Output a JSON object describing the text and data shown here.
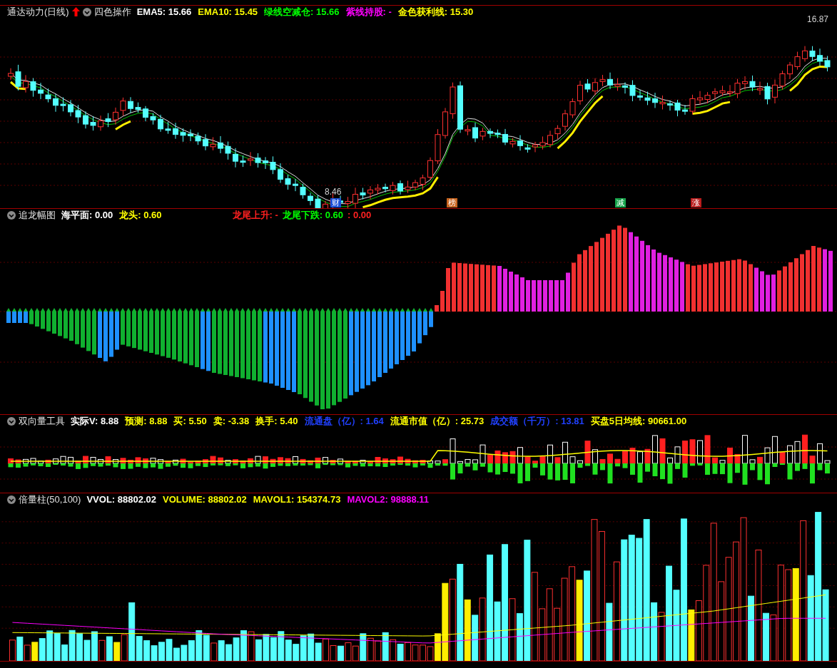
{
  "main_panel": {
    "title": "通达动力(日线)",
    "indicator": "四色操作",
    "values": [
      {
        "text": "EMA5: 15.66",
        "color": "#ffffff"
      },
      {
        "text": "EMA10: 15.45",
        "color": "#ffff00"
      },
      {
        "text": "绿线空减仓: 15.66",
        "color": "#00ff00"
      },
      {
        "text": "紫线持股: -",
        "color": "#ff00ff"
      },
      {
        "text": "金色获利线: 15.30",
        "color": "#ffff00"
      }
    ],
    "high_label": "16.87",
    "low_label": "8.46",
    "markers": [
      {
        "text": "财",
        "color": "#1a4fd6"
      },
      {
        "text": "榜",
        "color": "#c8641e"
      },
      {
        "text": "减",
        "color": "#16a34a"
      },
      {
        "text": "涨",
        "color": "#b91c1c"
      }
    ]
  },
  "dragon_panel": {
    "title": "追龙幅图",
    "values": [
      {
        "text": "海平面: 0.00",
        "color": "#ffffff"
      },
      {
        "text": "龙头: 0.60",
        "color": "#ffff00"
      }
    ],
    "values_right": [
      {
        "text": "龙尾上升: -",
        "color": "#ff2020"
      },
      {
        "text": "龙尾下跌: 0.60",
        "color": "#00ff00"
      },
      {
        "text": ": 0.00",
        "color": "#ff2020"
      }
    ]
  },
  "volume_tool_panel": {
    "title": "双向量工具",
    "values": [
      {
        "text": "实际V: 8.88",
        "color": "#ffffff"
      },
      {
        "text": "预测: 8.88",
        "color": "#ffff00"
      },
      {
        "text": "买: 5.50",
        "color": "#ffff00"
      },
      {
        "text": "卖: -3.38",
        "color": "#ffff00"
      },
      {
        "text": "换手: 5.40",
        "color": "#ffff00"
      },
      {
        "text": "流通盘（亿）: 1.64",
        "color": "#2040ff"
      },
      {
        "text": "流通市值（亿）: 25.73",
        "color": "#ffff00"
      },
      {
        "text": "成交额（千万）: 13.81",
        "color": "#2040ff"
      },
      {
        "text": "买盘5日均线: 90661.00",
        "color": "#ffff00"
      }
    ]
  },
  "volume_panel": {
    "title": "倍量柱(50,100)",
    "values": [
      {
        "text": "VVOL: 88802.02",
        "color": "#ffffff"
      },
      {
        "text": "VOLUME: 88802.02",
        "color": "#ffff00"
      },
      {
        "text": "MAVOL1: 154374.73",
        "color": "#ffff00"
      },
      {
        "text": "MAVOL2: 98888.11",
        "color": "#ff00ff"
      }
    ]
  }
}
